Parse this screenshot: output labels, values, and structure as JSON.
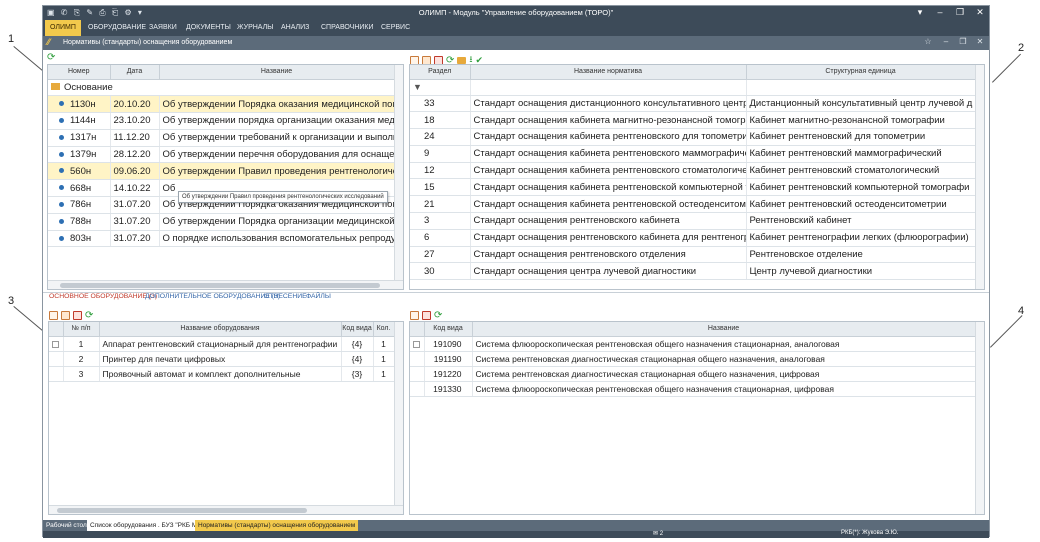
{
  "app": {
    "title": "ОЛИМП - Модуль \"Управление оборудованием (ТОРО)\"",
    "qat_icons": "▣ ✆ ⎘ ✎ ⎙ ⎗ ⚙ ▾",
    "win_buttons": [
      "▾",
      "–",
      "❐",
      "✕"
    ],
    "doc_win_buttons": [
      "☆",
      "–",
      "❐",
      "✕"
    ]
  },
  "menu": [
    "ОЛИМП",
    "ОБОРУДОВАНИЕ",
    "ЗАЯВКИ",
    "ДОКУМЕНТЫ",
    "ЖУРНАЛЫ",
    "АНАЛИЗ",
    "СПРАВОЧНИКИ",
    "СЕРВИС"
  ],
  "doc_tab": {
    "logo": "⁄⁄",
    "title": "Нормативы (стандарты) оснащения оборудованием"
  },
  "callouts": [
    "1",
    "2",
    "3",
    "4"
  ],
  "left_top": {
    "columns": [
      "Номер",
      "Дата",
      "Название"
    ],
    "group": "Основание",
    "rows": [
      {
        "num": "1130н",
        "date": "20.10.20",
        "name": "Об утверждении Порядка оказания медицинской пом..",
        "hl": true
      },
      {
        "num": "1144н",
        "date": "23.10.20",
        "name": "Об утверждении порядка организации оказания меди..",
        "hl": false
      },
      {
        "num": "1317н",
        "date": "11.12.20",
        "name": "Об утверждении требований к организации и выполн..",
        "hl": false
      },
      {
        "num": "1379н",
        "date": "28.12.20",
        "name": "Об утверждении перечня оборудования для оснащен..",
        "hl": false
      },
      {
        "num": "560н",
        "date": "09.06.20",
        "name": "Об утверждении Правил проведения рентгенологиче..",
        "hl": true
      },
      {
        "num": "668н",
        "date": "14.10.22",
        "name": "Об",
        "hl": false
      },
      {
        "num": "786н",
        "date": "31.07.20",
        "name": "Об утверждении Порядка оказания медицинской пом..",
        "hl": false
      },
      {
        "num": "788н",
        "date": "31.07.20",
        "name": "Об утверждении Порядка организации медицинской ..",
        "hl": false
      },
      {
        "num": "803н",
        "date": "31.07.20",
        "name": "О порядке использования вспомогательных репроду..",
        "hl": false
      }
    ],
    "tooltip": "Об утверждении Правил проведения рентгенологических исследований"
  },
  "right_top": {
    "columns": [
      "Раздел",
      "Название норматива",
      "Структурная единица"
    ],
    "rows": [
      {
        "sec": "33",
        "name": "Стандарт оснащения дистанционного консультативного центр",
        "unit": "Дистанционный консультативный центр лучевой д"
      },
      {
        "sec": "18",
        "name": "Стандарт оснащения кабинета магнитно-резонансной томогра",
        "unit": "Кабинет магнитно-резонансной томографии"
      },
      {
        "sec": "24",
        "name": "Стандарт оснащения кабинета рентгеновского для топометрии",
        "unit": "Кабинет рентгеновский для топометрии"
      },
      {
        "sec": "9",
        "name": "Стандарт оснащения кабинета рентгеновского маммографиче",
        "unit": "Кабинет рентгеновский маммографический"
      },
      {
        "sec": "12",
        "name": "Стандарт оснащения кабинета рентгеновского стоматологиче",
        "unit": "Кабинет рентгеновский стоматологический"
      },
      {
        "sec": "15",
        "name": "Стандарт оснащения кабинета рентгеновской компьютерной т",
        "unit": "Кабинет рентгеновский компьютерной томографи"
      },
      {
        "sec": "21",
        "name": "Стандарт оснащения кабинета рентгеновской остеоденситоме",
        "unit": "Кабинет рентгеновский остеоденситометрии"
      },
      {
        "sec": "3",
        "name": "Стандарт оснащения рентгеновского кабинета",
        "unit": "Рентгеновский кабинет"
      },
      {
        "sec": "6",
        "name": "Стандарт оснащения рентгеновского кабинета для рентгеногр",
        "unit": "Кабинет рентгенографии легких (флюорографии)"
      },
      {
        "sec": "27",
        "name": "Стандарт оснащения рентгеновского отделения",
        "unit": "Рентгеновское отделение"
      },
      {
        "sec": "30",
        "name": "Стандарт оснащения центра лучевой диагностики",
        "unit": "Центр лучевой диагностики"
      }
    ]
  },
  "subtabs": [
    "ОСНОВНОЕ ОБОРУДОВАНИЕ (3)",
    "ДОПОЛНИТЕЛЬНОЕ ОБОРУДОВАНИЕ (3)",
    "ОТНЕСЕНИЕ",
    "ФАЙЛЫ"
  ],
  "left_bottom": {
    "columns": [
      "№ п/п",
      "Название оборудования",
      "Код вида",
      "Кол."
    ],
    "rows": [
      {
        "n": "1",
        "name": "Аппарат рентгеновский стационарный для рентгенографии",
        "code": "{4}",
        "qty": "1"
      },
      {
        "n": "2",
        "name": "Принтер для печати цифровых",
        "code": "{4}",
        "qty": "1"
      },
      {
        "n": "3",
        "name": "Проявочный автомат и комплект дополнительные",
        "code": "{3}",
        "qty": "1"
      }
    ]
  },
  "right_bottom": {
    "columns": [
      "Код вида",
      "Название"
    ],
    "rows": [
      {
        "code": "191090",
        "name": "Система флюороскопическая рентгеновская общего назначения стационарная, аналоговая"
      },
      {
        "code": "191190",
        "name": "Система рентгеновская диагностическая стационарная общего назначения, аналоговая"
      },
      {
        "code": "191220",
        "name": "Система рентгеновская диагностическая стационарная общего назначения, цифровая"
      },
      {
        "code": "191330",
        "name": "Система флюороскопическая рентгеновская общего назначения стационарная, цифровая"
      }
    ]
  },
  "status_tabs": [
    "Рабочий стол",
    "Список оборудования . БУЗ \"РКБ МЗ\"",
    "Нормативы (стандарты) оснащения оборудованием"
  ],
  "bottom": {
    "mail": "✉ 2",
    "user": "РКБ(*): Жукова Э.Ю."
  }
}
